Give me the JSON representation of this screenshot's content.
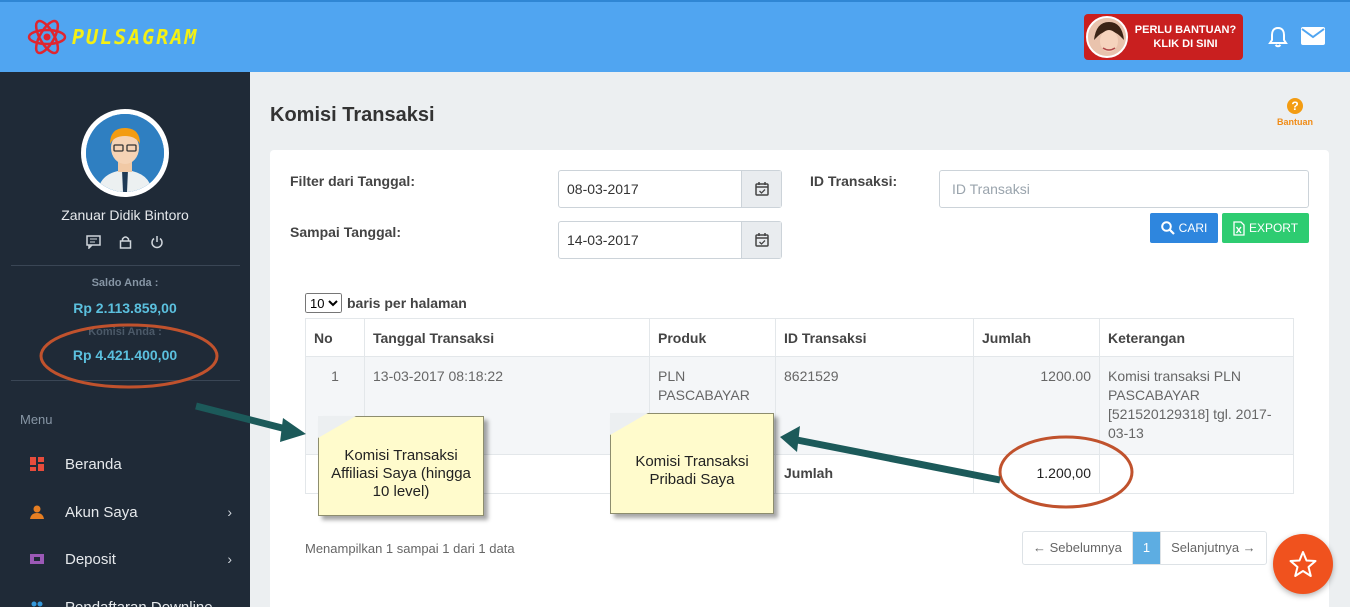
{
  "brand": {
    "name": "PULSAGRAM"
  },
  "header": {
    "help_line1": "PERLU BANTUAN?",
    "help_line2": "KLIK DI SINI"
  },
  "sidebar": {
    "user_name": "Zanuar Didik Bintoro",
    "saldo_label": "Saldo Anda :",
    "saldo_value": "Rp 2.113.859,00",
    "komisi_label": "Komisi Anda :",
    "komisi_value": "Rp 4.421.400,00",
    "menu_heading": "Menu",
    "items": [
      {
        "label": "Beranda",
        "icon": "dashboard-icon",
        "color": "#e74c3c"
      },
      {
        "label": "Akun Saya",
        "icon": "user-icon",
        "color": "#e67e22"
      },
      {
        "label": "Deposit",
        "icon": "wallet-icon",
        "color": "#9b59b6"
      },
      {
        "label": "Pendaftaran Downline",
        "icon": "users-icon",
        "color": "#3498db"
      }
    ]
  },
  "page": {
    "title": "Komisi Transaksi",
    "help_label": "Bantuan"
  },
  "filter": {
    "from_label": "Filter dari Tanggal:",
    "from_value": "08-03-2017",
    "to_label": "Sampai Tanggal:",
    "to_value": "14-03-2017",
    "id_label": "ID Transaksi:",
    "id_placeholder": "ID Transaksi",
    "search_label": "CARI",
    "export_label": "EXPORT"
  },
  "table": {
    "per_page_value": "10",
    "per_page_label": "baris per halaman",
    "columns": [
      "No",
      "Tanggal Transaksi",
      "Produk",
      "ID Transaksi",
      "Jumlah",
      "Keterangan"
    ],
    "rows": [
      {
        "no": "1",
        "date": "13-03-2017 08:18:22",
        "product": "PLN PASCABAYAR",
        "id": "8621529",
        "amount": "1200.00",
        "note": "Komisi transaksi PLN PASCABAYAR [521520129318] tgl. 2017-03-13"
      }
    ],
    "total_label": "Jumlah",
    "total_value": "1.200,00"
  },
  "pagination": {
    "info": "Menampilkan 1 sampai 1 dari 1 data",
    "prev_label": "← Sebelumnya",
    "current": "1",
    "next_label": "Selanjutnya →"
  },
  "annotations": {
    "affiliate_note": "Komisi Transaksi Affiliasi Saya (hingga 10 level)",
    "personal_note": "Komisi Transaksi Pribadi Saya"
  },
  "colors": {
    "topbar": "#50a5f1",
    "sidebar": "#1f2a37",
    "accent_value": "#5bc0de",
    "search_button": "#2e86de",
    "export_button": "#2ecc71",
    "fab": "#f0521e",
    "highlight_ellipse": "#c0522d",
    "arrow": "#1c5a5a"
  }
}
